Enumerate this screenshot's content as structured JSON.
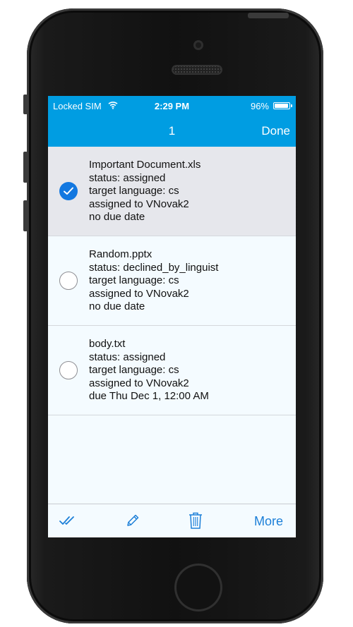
{
  "status_bar": {
    "carrier": "Locked SIM",
    "time": "2:29 PM",
    "battery": "96%"
  },
  "nav": {
    "title": "1",
    "done_label": "Done"
  },
  "items": [
    {
      "name": "Important Document.xls",
      "status": "status: assigned",
      "language": "target language: cs",
      "assignee": "assigned to VNovak2",
      "due": "no due date",
      "selected": true
    },
    {
      "name": "Random.pptx",
      "status": "status: declined_by_linguist",
      "language": "target language: cs",
      "assignee": "assigned to VNovak2",
      "due": "no due date",
      "selected": false
    },
    {
      "name": "body.txt",
      "status": "status: assigned",
      "language": "target language: cs",
      "assignee": "assigned to VNovak2",
      "due": "due Thu Dec 1, 12:00 AM",
      "selected": false
    }
  ],
  "toolbar": {
    "more_label": "More",
    "icons": [
      "double-check-icon",
      "pencil-icon",
      "trash-icon"
    ]
  },
  "colors": {
    "header": "#009de2",
    "accent": "#1378e0",
    "selected_row": "#e6e7ec"
  }
}
